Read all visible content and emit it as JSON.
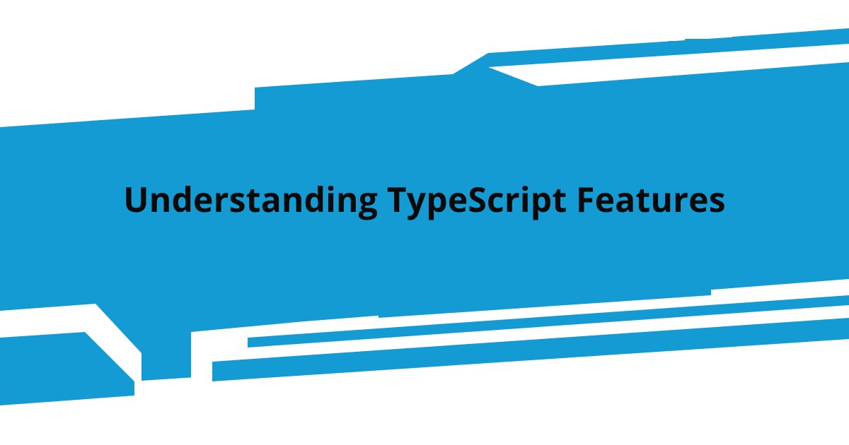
{
  "banner": {
    "title": "Understanding TypeScript Features",
    "accent_color": "#159bd3",
    "text_color": "#0a0a0a",
    "background_color": "#ffffff"
  }
}
